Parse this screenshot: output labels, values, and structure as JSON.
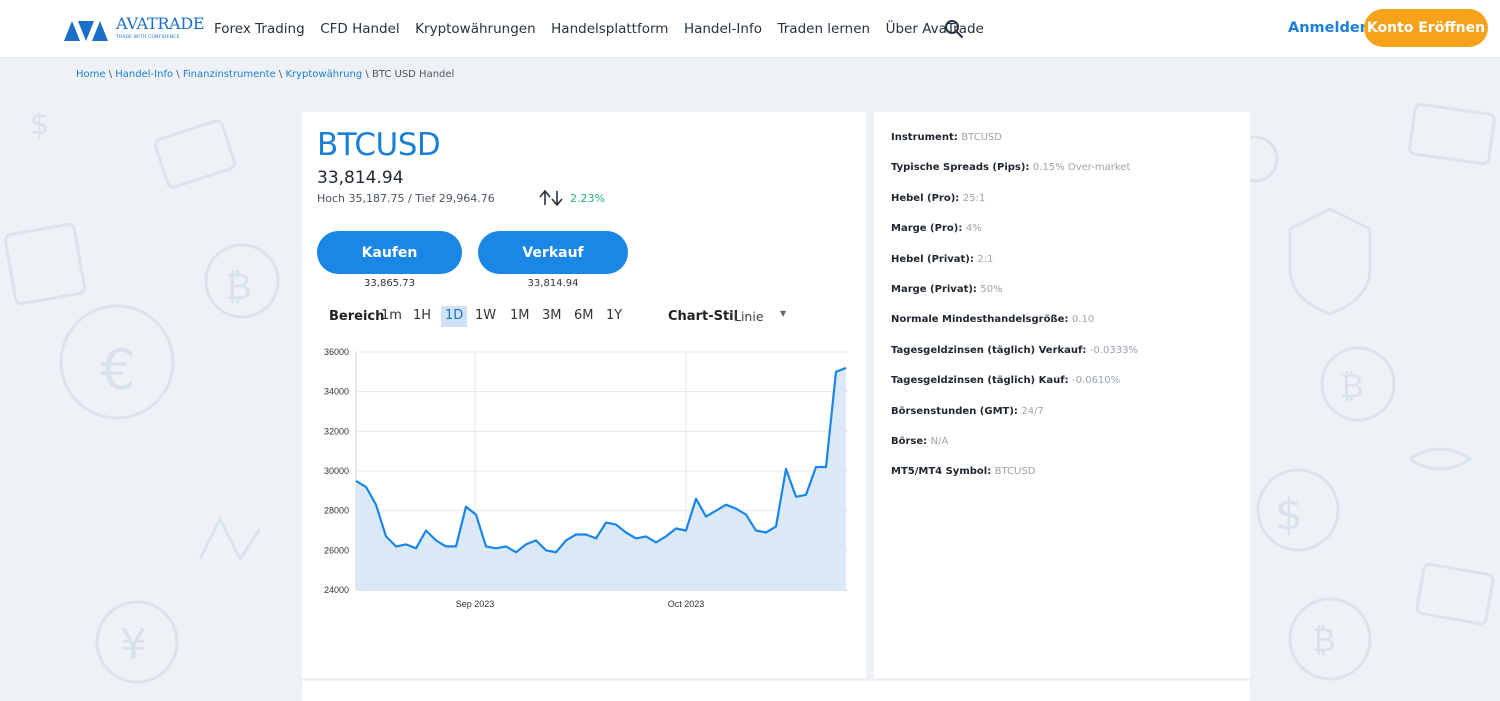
{
  "header": {
    "logo_text": "AVATRADE",
    "logo_tagline": "TRADE WITH CONFIDENCE",
    "nav": [
      "Forex Trading",
      "CFD Handel",
      "Kryptowährungen",
      "Handelsplattform",
      "Handel-Info",
      "Traden lernen",
      "Über AvaTrade"
    ],
    "login": "Anmelden",
    "open_account": "Konto Eröffnen"
  },
  "breadcrumb": {
    "items": [
      "Home",
      "Handel-Info",
      "Finanzinstrumente",
      "Kryptowährung"
    ],
    "separator": "\\",
    "current": "BTC USD Handel"
  },
  "instrument": {
    "symbol": "BTCUSD",
    "price": "33,814.94",
    "high_low": "Hoch 35,187.75 / Tief 29,964.76",
    "change": "2.23%",
    "buy_label": "Kaufen",
    "buy_price": "33,865.73",
    "sell_label": "Verkauf",
    "sell_price": "33,814.94"
  },
  "controls": {
    "range_label": "Bereich",
    "ranges": [
      "1m",
      "1H",
      "1D",
      "1W",
      "1M",
      "3M",
      "6M",
      "1Y"
    ],
    "active_range": "1D",
    "style_label": "Chart-Stil",
    "style_value": "Linie"
  },
  "chart_data": {
    "type": "area",
    "title": "",
    "xlabel": "",
    "ylabel": "",
    "x_ticks": [
      "Sep 2023",
      "Oct 2023"
    ],
    "y_ticks": [
      24000,
      26000,
      28000,
      30000,
      32000,
      34000,
      36000
    ],
    "ylim": [
      24000,
      36000
    ],
    "grid": true,
    "color": "#1a86e6",
    "fill": "#dbe8f5",
    "series": [
      {
        "values": [
          29500,
          29200,
          28300,
          26700,
          26200,
          26300,
          26100,
          27000,
          26500,
          26200,
          26200,
          28200,
          27800,
          26200,
          26100,
          26200,
          25900,
          26300,
          26500,
          26000,
          25900,
          26500,
          26800,
          26800,
          26600,
          27400,
          27300,
          26900,
          26600,
          26700,
          26400,
          26700,
          27100,
          27000,
          28600,
          27700,
          28000,
          28300,
          28100,
          27800,
          27000,
          26900,
          27200,
          30100,
          28700,
          28800,
          30200,
          30200,
          35000,
          35200
        ]
      }
    ]
  },
  "info": [
    {
      "label": "Instrument:",
      "value": "BTCUSD"
    },
    {
      "label": "Typische Spreads (Pips):",
      "value": "0.15% Over-market"
    },
    {
      "label": "Hebel (Pro):",
      "value": "25:1"
    },
    {
      "label": "Marge (Pro):",
      "value": "4%"
    },
    {
      "label": "Hebel (Privat):",
      "value": "2:1"
    },
    {
      "label": "Marge (Privat):",
      "value": "50%"
    },
    {
      "label": "Normale Mindesthandelsgröße:",
      "value": "0.10"
    },
    {
      "label": "Tagesgeldzinsen (täglich) Verkauf:",
      "value": "-0.0333%"
    },
    {
      "label": "Tagesgeldzinsen (täglich) Kauf:",
      "value": "-0.0610%"
    },
    {
      "label": "Börsenstunden (GMT):",
      "value": "24/7"
    },
    {
      "label": "Börse:",
      "value": "N/A"
    },
    {
      "label": "MT5/MT4 Symbol:",
      "value": "BTCUSD"
    }
  ],
  "colors": {
    "brand_blue": "#1a86e6",
    "accent_orange": "#f7a21b",
    "positive_green": "#22b573"
  }
}
